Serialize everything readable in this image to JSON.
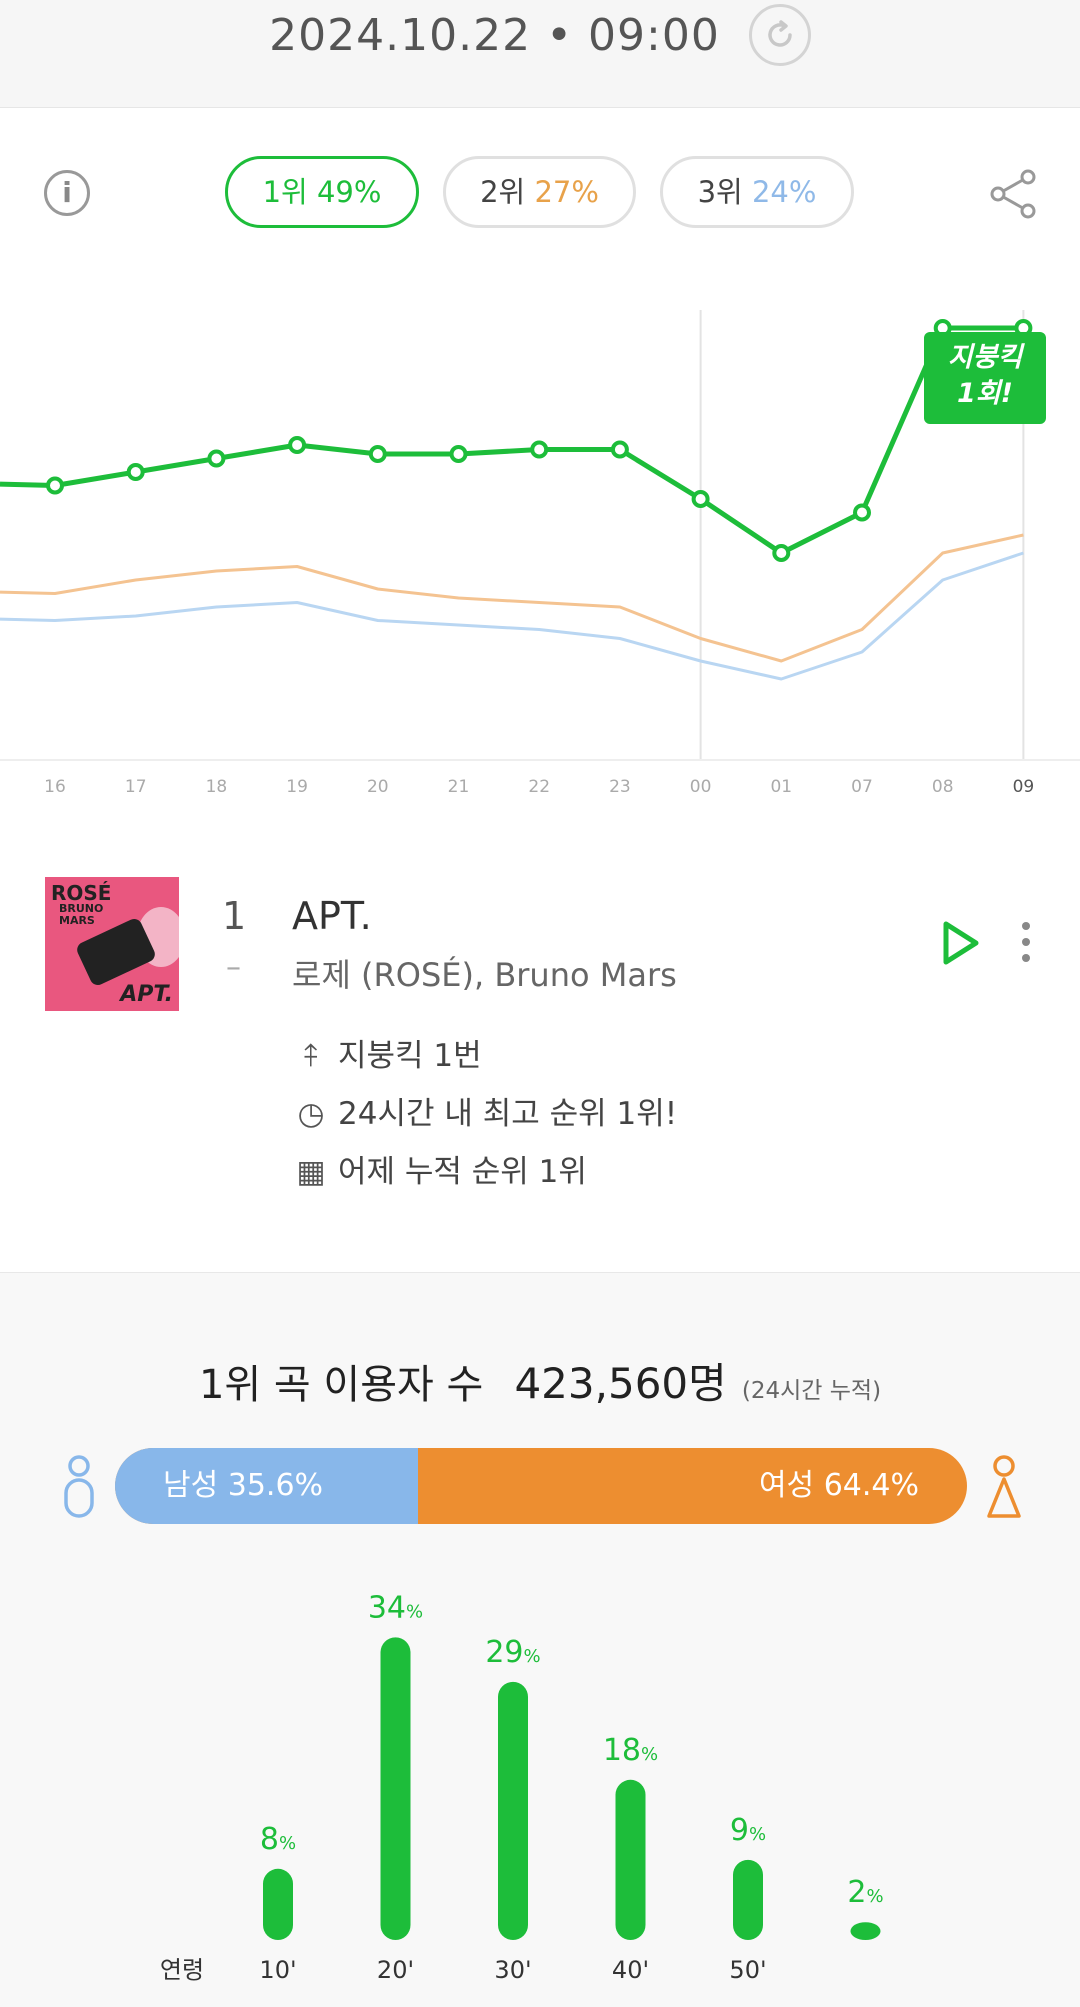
{
  "header": {
    "timestamp": "2024.10.22 • 09:00"
  },
  "rank_tabs": [
    {
      "rank": "1위",
      "pct": "49%",
      "pct_color": "#1dbd3a",
      "active": true
    },
    {
      "rank": "2위",
      "pct": "27%",
      "pct_color": "#e8a24a",
      "active": false
    },
    {
      "rank": "3위",
      "pct": "24%",
      "pct_color": "#8fb9e8",
      "active": false
    }
  ],
  "chart_data": {
    "type": "line",
    "x": [
      "16",
      "17",
      "18",
      "19",
      "20",
      "21",
      "22",
      "23",
      "00",
      "01",
      "07",
      "08",
      "09"
    ],
    "series": [
      {
        "values": [
          61,
          64,
          67,
          70,
          68,
          68,
          69,
          69,
          58,
          46,
          55,
          96,
          96
        ],
        "color": "#1dbd3a"
      },
      {
        "values": [
          37,
          40,
          42,
          43,
          38,
          36,
          35,
          34,
          27,
          22,
          29,
          46,
          50
        ],
        "color": "#f4c391"
      },
      {
        "values": [
          31,
          32,
          34,
          35,
          31,
          30,
          29,
          27,
          22,
          18,
          24,
          40,
          46
        ],
        "color": "#b9d6f2"
      }
    ],
    "ylim": [
      0,
      100
    ],
    "grid": false,
    "annotation": "지붕킥 1회!"
  },
  "song": {
    "rank": "1",
    "change": "–",
    "title": "APT.",
    "artist": "로제 (ROSÉ), Bruno Mars",
    "album_art": {
      "line1": "ROSÉ",
      "line2": "BRUNO\nMARS",
      "line3": "APT."
    },
    "features": [
      {
        "icon": "kick-icon",
        "text": "지붕킥 1번"
      },
      {
        "icon": "clock-icon",
        "text": "24시간 내 최고 순위 1위!"
      },
      {
        "icon": "calendar-icon",
        "text": "어제 누적 순위 1위"
      }
    ]
  },
  "listeners": {
    "label": "1위 곡 이용자 수",
    "count": "423,560명",
    "note": "(24시간 누적)"
  },
  "gender": {
    "male_label": "남성 35.6%",
    "female_label": "여성 64.4%",
    "male_pct": 35.6,
    "female_pct": 64.4,
    "male_color": "#88b7ea",
    "female_color": "#ed8e30"
  },
  "age": {
    "axis_label": "연령",
    "categories": [
      "10'",
      "20'",
      "30'",
      "40'",
      "50'"
    ],
    "values": [
      8,
      34,
      29,
      18,
      9,
      2
    ],
    "extra_label": "2%"
  }
}
